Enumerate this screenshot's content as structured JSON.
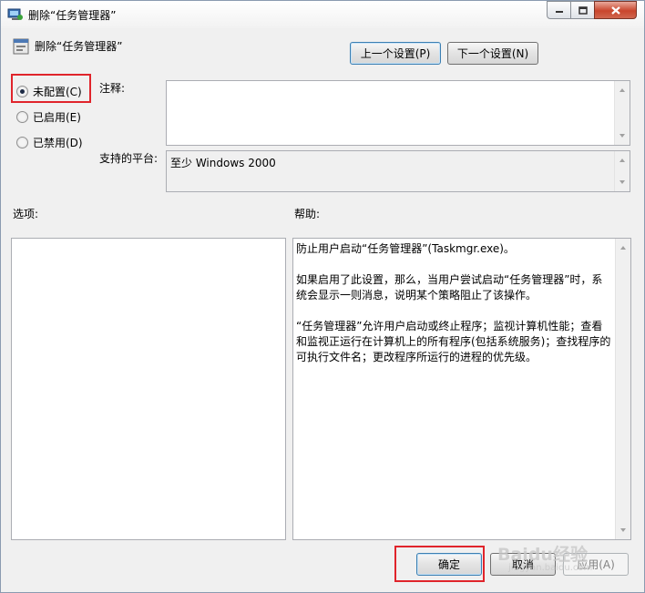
{
  "window": {
    "title": "删除“任务管理器”",
    "minimize_icon": "minimize-icon",
    "maximize_icon": "maximize-icon",
    "close_icon": "close-icon"
  },
  "header": {
    "title": "删除“任务管理器”",
    "icon": "policy-setting-icon",
    "prev_button": "上一个设置(P)",
    "next_button": "下一个设置(N)"
  },
  "state_options": [
    {
      "label": "未配置(C)",
      "checked": true
    },
    {
      "label": "已启用(E)",
      "checked": false
    },
    {
      "label": "已禁用(D)",
      "checked": false
    }
  ],
  "comment": {
    "label": "注释:",
    "value": ""
  },
  "platform": {
    "label": "支持的平台:",
    "value": "至少 Windows 2000"
  },
  "options": {
    "label": "选项:"
  },
  "help": {
    "label": "帮助:",
    "text": "防止用户启动“任务管理器”(Taskmgr.exe)。\n\n如果启用了此设置，那么，当用户尝试启动“任务管理器”时，系统会显示一则消息，说明某个策略阻止了该操作。\n\n“任务管理器”允许用户启动或终止程序；监视计算机性能；查看和监视正运行在计算机上的所有程序(包括系统服务)；查找程序的可执行文件名；更改程序所运行的进程的优先级。"
  },
  "footer": {
    "ok_button": "确定",
    "cancel_button": "取消",
    "apply_button": "应用(A)"
  },
  "watermark": {
    "text": "Baidu经验",
    "sub": "jingyan.baidu.com"
  },
  "colors": {
    "highlight": "#e0242b",
    "window_bg": "#f0f0f0"
  }
}
